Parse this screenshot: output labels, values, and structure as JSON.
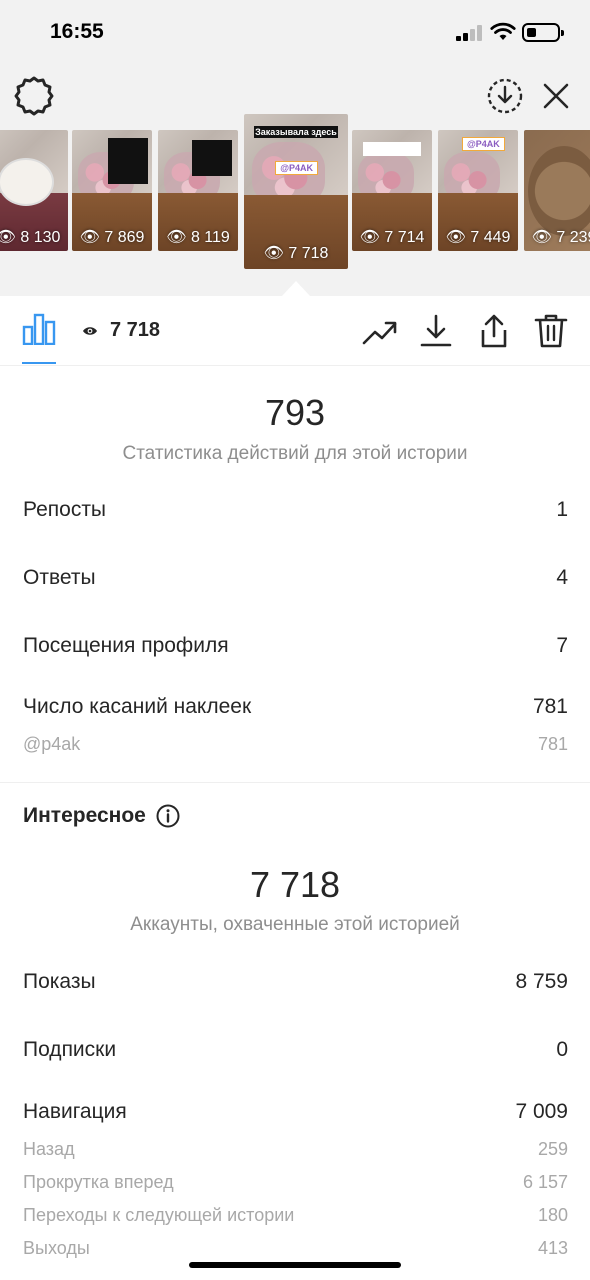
{
  "status_bar": {
    "time": "16:55"
  },
  "stories": [
    {
      "views": "8 130"
    },
    {
      "views": "7 869"
    },
    {
      "views": "8 119"
    },
    {
      "views": "7 718",
      "caption": "Заказывала здесь",
      "brand": "@P4AK",
      "selected": true
    },
    {
      "views": "7 714"
    },
    {
      "views": "7 449",
      "brand": "@P4AK"
    },
    {
      "views": "7 239"
    }
  ],
  "toolbar": {
    "view_count": "7 718"
  },
  "actions": {
    "total": "793",
    "caption": "Статистика действий для этой истории",
    "rows": [
      {
        "label": "Репосты",
        "value": "1"
      },
      {
        "label": "Ответы",
        "value": "4"
      },
      {
        "label": "Посещения профиля",
        "value": "7"
      },
      {
        "label": "Число касаний наклеек",
        "value": "781"
      }
    ],
    "sticker_sub": {
      "label": "@p4ak",
      "value": "781"
    }
  },
  "discovery": {
    "title": "Интересное",
    "total": "7 718",
    "caption": "Аккаунты, охваченные этой историей",
    "rows": [
      {
        "label": "Показы",
        "value": "8 759"
      },
      {
        "label": "Подписки",
        "value": "0"
      },
      {
        "label": "Навигация",
        "value": "7 009"
      }
    ],
    "navigation_sub": [
      {
        "label": "Назад",
        "value": "259"
      },
      {
        "label": "Прокрутка вперед",
        "value": "6 157"
      },
      {
        "label": "Переходы к следующей истории",
        "value": "180"
      },
      {
        "label": "Выходы",
        "value": "413"
      }
    ]
  },
  "colors": {
    "accent": "#3897f0",
    "text": "#262626",
    "muted": "#8e8e8e"
  }
}
